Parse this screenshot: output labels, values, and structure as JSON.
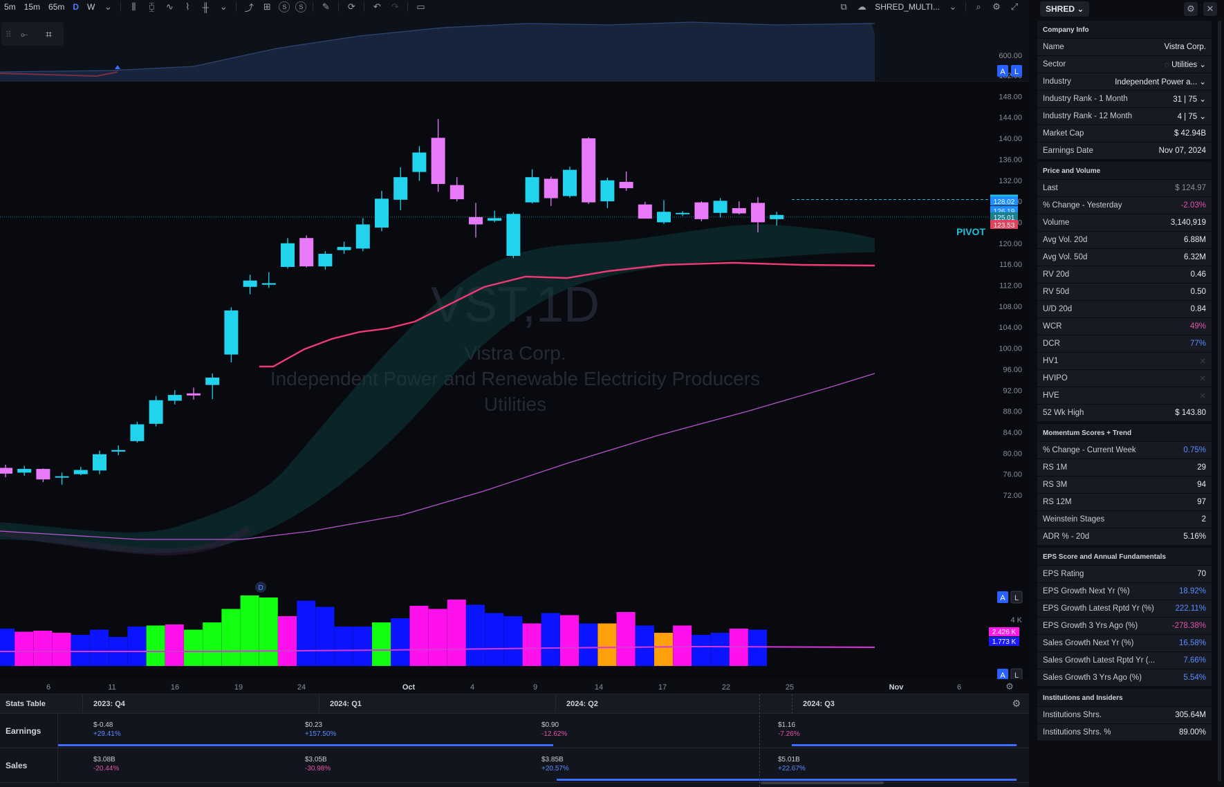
{
  "toolbar": {
    "intervals": [
      "5m",
      "15m",
      "65m",
      "D",
      "W"
    ],
    "active_interval": "D",
    "layout_name": "SHRED_MULTI..."
  },
  "chart": {
    "watermark_symbol": "VST,1D",
    "watermark_name": "Vistra Corp.",
    "watermark_industry": "Independent Power and Renewable Electricity Producers",
    "watermark_sector": "Utilities",
    "pivot_label": "PIVOT",
    "top_scale_label": "600.00",
    "price_ticks": [
      "152.00",
      "148.00",
      "144.00",
      "140.00",
      "136.00",
      "132.00",
      "128.00",
      "124.00",
      "120.00",
      "116.00",
      "112.00",
      "108.00",
      "104.00",
      "100.00",
      "96.00",
      "92.00",
      "88.00",
      "84.00",
      "80.00",
      "76.00",
      "72.00"
    ],
    "price_badges": [
      {
        "text": "128.35",
        "color": "#22c1d8"
      },
      {
        "text": "128.02",
        "color": "#1f8fff"
      },
      {
        "text": "126.19",
        "color": "#1f8fff"
      },
      {
        "text": "125.01",
        "color": "#1a7f8f"
      },
      {
        "text": "123.53",
        "color": "#e0435e"
      }
    ],
    "volume_scale_label": "4 K",
    "volume_badges": [
      {
        "text": "2.426 K",
        "color": "#ff1ae8"
      },
      {
        "text": "1.773 K",
        "color": "#1a1aff"
      }
    ],
    "date_labels": [
      "6",
      "11",
      "16",
      "19",
      "24",
      "Oct",
      "4",
      "9",
      "14",
      "17",
      "22",
      "25",
      "Nov",
      "6"
    ],
    "pane_buttons": [
      "A",
      "L"
    ],
    "d_marker": "D"
  },
  "chart_data": {
    "type": "candlestick",
    "candles": [
      [
        77.2,
        76.1,
        77.8,
        75.4
      ],
      [
        76.3,
        77.0,
        77.6,
        75.7
      ],
      [
        77.0,
        75.0,
        77.1,
        74.5
      ],
      [
        75.6,
        75.6,
        76.3,
        74.0
      ],
      [
        76.0,
        76.8,
        77.4,
        75.8
      ],
      [
        76.7,
        79.8,
        80.5,
        76.0
      ],
      [
        80.3,
        80.6,
        81.5,
        79.6
      ],
      [
        82.3,
        85.5,
        86.0,
        82.0
      ],
      [
        85.6,
        90.1,
        90.9,
        85.1
      ],
      [
        90.0,
        91.1,
        92.0,
        89.3
      ],
      [
        91.4,
        91.0,
        92.5,
        90.2
      ],
      [
        93.0,
        94.4,
        95.2,
        90.3
      ],
      [
        98.8,
        107.2,
        107.8,
        97.3
      ],
      [
        111.7,
        112.9,
        114.0,
        110.3
      ],
      [
        112.1,
        112.4,
        114.5,
        111.5
      ],
      [
        115.5,
        120.0,
        121.0,
        115.2
      ],
      [
        121.0,
        115.6,
        121.5,
        115.4
      ],
      [
        115.6,
        118.0,
        118.5,
        115.0
      ],
      [
        118.7,
        119.3,
        120.3,
        118.0
      ],
      [
        119.0,
        123.6,
        124.8,
        118.5
      ],
      [
        123.0,
        128.5,
        130.0,
        122.3
      ],
      [
        128.3,
        132.6,
        134.5,
        126.3
      ],
      [
        133.6,
        137.3,
        138.5,
        131.9
      ],
      [
        140.1,
        131.3,
        143.7,
        129.8
      ],
      [
        131.1,
        128.4,
        132.6,
        128.0
      ],
      [
        125.0,
        123.6,
        127.7,
        121.1
      ],
      [
        124.3,
        124.8,
        126.2,
        124.0
      ],
      [
        117.6,
        125.6,
        125.9,
        117.2
      ],
      [
        127.8,
        132.6,
        134.1,
        127.6
      ],
      [
        132.3,
        128.6,
        132.7,
        127.1
      ],
      [
        129.0,
        134.0,
        134.6,
        128.7
      ],
      [
        140.0,
        127.8,
        140.2,
        127.5
      ],
      [
        128.0,
        132.0,
        132.5,
        126.7
      ],
      [
        131.7,
        130.5,
        133.7,
        130.0
      ],
      [
        127.4,
        124.7,
        127.9,
        124.7
      ],
      [
        124.0,
        126.0,
        128.2,
        123.7
      ],
      [
        125.8,
        125.8,
        126.1,
        125.2
      ],
      [
        127.8,
        124.6,
        128.0,
        124.2
      ],
      [
        125.8,
        128.1,
        128.6,
        124.9
      ],
      [
        126.7,
        125.7,
        128.0,
        125.5
      ],
      [
        127.7,
        124.0,
        128.8,
        122.1
      ],
      [
        124.6,
        125.4,
        126.0,
        123.4
      ]
    ],
    "candle_colors": [
      "#22d3ee",
      "#e879f9"
    ],
    "volume": [
      1.8,
      1.65,
      1.7,
      1.6,
      1.5,
      1.75,
      1.4,
      1.9,
      1.95,
      2.0,
      1.75,
      2.1,
      2.75,
      3.4,
      3.3,
      2.4,
      3.15,
      2.85,
      1.9,
      1.9,
      2.1,
      2.3,
      2.9,
      2.75,
      3.2,
      2.95,
      2.55,
      2.4,
      2.05,
      2.55,
      2.45,
      2.05,
      2.05,
      2.6,
      1.95,
      1.6,
      1.95,
      1.5,
      1.6,
      1.8,
      1.75,
      1.5,
      1.45
    ],
    "volume_colors": [
      "#0a14ff",
      "#ff11ee",
      "#ff11ee",
      "#ff11ee",
      "#0a14ff",
      "#0a14ff",
      "#0a14ff",
      "#0a14ff",
      "#12ff12",
      "#ff11ee",
      "#12ff12",
      "#12ff12",
      "#12ff12",
      "#12ff12",
      "#12ff12",
      "#ff11ee",
      "#0a14ff",
      "#0a14ff",
      "#0a14ff",
      "#0a14ff",
      "#12ff12",
      "#0a14ff",
      "#ff11ee",
      "#ff11ee",
      "#ff11ee",
      "#0a14ff",
      "#0a14ff",
      "#0a14ff",
      "#ff11ee",
      "#0a14ff",
      "#ff11ee",
      "#0a14ff",
      "#ff9f0a",
      "#ff11ee",
      "#0a14ff",
      "#ff9f0a",
      "#ff11ee",
      "#0a14ff",
      "#0a14ff",
      "#ff11ee",
      "#0a14ff"
    ],
    "ylim": [
      70,
      154
    ],
    "pivot_price": 128.35,
    "current_price": 125.01
  },
  "stats": {
    "title": "Stats Table",
    "quarters": [
      "2023: Q4",
      "2024: Q1",
      "2024: Q2",
      "2024: Q3"
    ],
    "rows": [
      {
        "label": "Earnings",
        "cells": [
          {
            "v": "$-0.48",
            "c": "+29.41%"
          },
          {
            "v": "$0.23",
            "c": "+157.50%"
          },
          {
            "v": "$0.90",
            "c": "-12.62%"
          },
          {
            "v": "$1.16",
            "c": "-7.26%"
          }
        ]
      },
      {
        "label": "Sales",
        "cells": [
          {
            "v": "$3.08B",
            "c": "-20.44%"
          },
          {
            "v": "$3.05B",
            "c": "-30.98%"
          },
          {
            "v": "$3.85B",
            "c": "+20.57%"
          },
          {
            "v": "$5.01B",
            "c": "+22.67%"
          }
        ]
      }
    ]
  },
  "panel": {
    "dropdown": "SHRED",
    "company": {
      "title": "Company Info",
      "name_label": "Name",
      "name": "Vistra Corp.",
      "sector_label": "Sector",
      "sector": "Utilities",
      "industry_label": "Industry",
      "industry": "Independent Power a...",
      "rank1m_label": "Industry Rank - 1 Month",
      "rank1m": "31 | 75",
      "rank12m_label": "Industry Rank - 12 Month",
      "rank12m": "4 | 75",
      "mcap_label": "Market Cap",
      "mcap": "$ 42.94B",
      "earn_label": "Earnings Date",
      "earn": "Nov 07, 2024"
    },
    "pv": {
      "title": "Price and Volume",
      "rows": [
        {
          "label": "Last",
          "value": "$ 124.97",
          "tone": "muted"
        },
        {
          "label": "% Change - Yesterday",
          "value": "-2.03%",
          "tone": "pink"
        },
        {
          "label": "Volume",
          "value": "3,140,919",
          "tone": ""
        },
        {
          "label": "Avg Vol. 20d",
          "value": "6.88M",
          "tone": ""
        },
        {
          "label": "Avg Vol. 50d",
          "value": "6.32M",
          "tone": ""
        },
        {
          "label": "RV 20d",
          "value": "0.46",
          "tone": ""
        },
        {
          "label": "RV 50d",
          "value": "0.50",
          "tone": ""
        },
        {
          "label": "U/D 20d",
          "value": "0.84",
          "tone": ""
        },
        {
          "label": "WCR",
          "value": "49%",
          "tone": "pink"
        },
        {
          "label": "DCR",
          "value": "77%",
          "tone": "blue"
        },
        {
          "label": "HV1",
          "value": "",
          "tone": ""
        },
        {
          "label": "HVIPO",
          "value": "",
          "tone": ""
        },
        {
          "label": "HVE",
          "value": "",
          "tone": ""
        },
        {
          "label": "52 Wk High",
          "value": "$ 143.80",
          "tone": ""
        }
      ]
    },
    "momentum": {
      "title": "Momentum Scores + Trend",
      "rows": [
        {
          "label": "% Change - Current Week",
          "value": "0.75%",
          "tone": "blue"
        },
        {
          "label": "RS 1M",
          "value": "29",
          "tone": ""
        },
        {
          "label": "RS 3M",
          "value": "94",
          "tone": ""
        },
        {
          "label": "RS 12M",
          "value": "97",
          "tone": ""
        },
        {
          "label": "Weinstein Stages",
          "value": "2",
          "tone": ""
        },
        {
          "label": "ADR % - 20d",
          "value": "5.16%",
          "tone": ""
        }
      ]
    },
    "eps": {
      "title": "EPS Score and Annual Fundamentals",
      "rows": [
        {
          "label": "EPS Rating",
          "value": "70",
          "tone": ""
        },
        {
          "label": "EPS Growth Next Yr (%)",
          "value": "18.92%",
          "tone": "blue"
        },
        {
          "label": "EPS Growth Latest Rptd Yr (%)",
          "value": "222.11%",
          "tone": "blue"
        },
        {
          "label": "EPS Growth 3 Yrs Ago (%)",
          "value": "-278.38%",
          "tone": "pink"
        },
        {
          "label": "Sales Growth Next Yr (%)",
          "value": "16.58%",
          "tone": "blue"
        },
        {
          "label": "Sales Growth Latest Rptd Yr (...",
          "value": "7.66%",
          "tone": "blue"
        },
        {
          "label": "Sales Growth 3 Yrs Ago (%)",
          "value": "5.54%",
          "tone": "blue"
        }
      ]
    },
    "inst": {
      "title": "Institutions and Insiders",
      "rows": [
        {
          "label": "Institutions Shrs.",
          "value": "305.64M",
          "tone": ""
        },
        {
          "label": "Institutions Shrs. %",
          "value": "89.00%",
          "tone": ""
        }
      ]
    }
  }
}
